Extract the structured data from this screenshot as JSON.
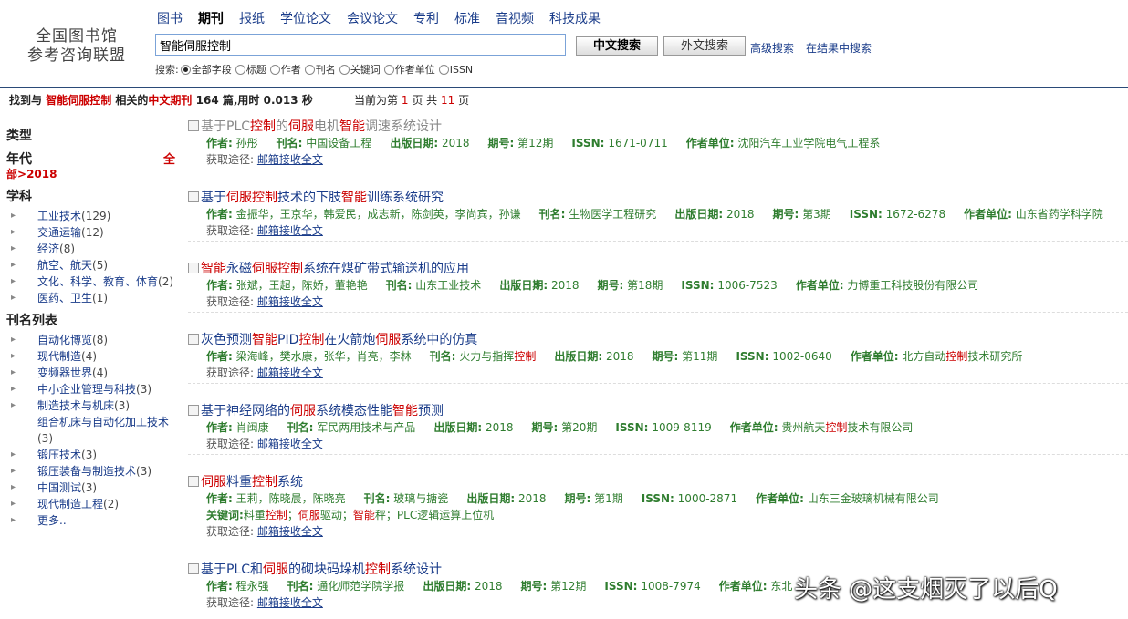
{
  "logo": {
    "line1": "全国图书馆",
    "line2": "参考咨询联盟"
  },
  "topnav": [
    "图书",
    "期刊",
    "报纸",
    "学位论文",
    "会议论文",
    "专利",
    "标准",
    "音视频",
    "科技成果"
  ],
  "search": {
    "value": "智能伺服控制",
    "btn_cn": "中文搜索",
    "btn_foreign": "外文搜索",
    "advanced": "高级搜索",
    "within": "在结果中搜索"
  },
  "searchby": {
    "label": "搜索:",
    "options": [
      "全部字段",
      "标题",
      "作者",
      "刊名",
      "关键词",
      "作者单位",
      "ISSN"
    ]
  },
  "summary": {
    "p1": "找到与",
    "kw": "智能伺服控制",
    "p2": "相关的",
    "type": "中文期刊",
    "count": "164",
    "p3": "篇,用时",
    "time": "0.013",
    "p4": "秒"
  },
  "pager": {
    "p1": "当前为第",
    "cur": "1",
    "p2": "页 共",
    "total": "11",
    "p3": "页"
  },
  "sidebar": {
    "type_heading": "类型",
    "year_heading": "年代",
    "year_all": "全",
    "year_all2": "部",
    "year_sel": ">2018",
    "subject_heading": "学科",
    "subjects": [
      {
        "name": "工业技术",
        "count": "(129)"
      },
      {
        "name": "交通运输",
        "count": "(12)"
      },
      {
        "name": "经济",
        "count": "(8)"
      },
      {
        "name": "航空、航天",
        "count": "(5)"
      },
      {
        "name": "文化、科学、教育、体育",
        "count": "(2)"
      },
      {
        "name": "医药、卫生",
        "count": "(1)"
      }
    ],
    "journal_heading": "刊名列表",
    "journals": [
      {
        "name": "自动化博览",
        "count": "(8)"
      },
      {
        "name": "现代制造",
        "count": "(4)"
      },
      {
        "name": "变频器世界",
        "count": "(4)"
      },
      {
        "name": "中小企业管理与科技",
        "count": "(3)"
      },
      {
        "name": "制造技术与机床",
        "count": "(3)"
      },
      {
        "name": "组合机床与自动化加工技术",
        "count": "(3)"
      },
      {
        "name": "锻压技术",
        "count": "(3)"
      },
      {
        "name": "锻压装备与制造技术",
        "count": "(3)"
      },
      {
        "name": "中国测试",
        "count": "(3)"
      },
      {
        "name": "现代制造工程",
        "count": "(2)"
      },
      {
        "name": "更多..",
        "count": ""
      }
    ]
  },
  "labels": {
    "author": "作者:",
    "journal": "刊名:",
    "date": "出版日期:",
    "issue": "期号:",
    "issn": "ISSN:",
    "unit": "作者单位:",
    "keywords": "关键词:",
    "via": "获取途径:",
    "via_link": "邮箱接收全文"
  },
  "results": [
    {
      "title": [
        [
          "基于PLC",
          0
        ],
        [
          "控制",
          1
        ],
        [
          "的",
          0
        ],
        [
          "伺服",
          1
        ],
        [
          "电机",
          0
        ],
        [
          "智能",
          1
        ],
        [
          "调速系统设计",
          0
        ]
      ],
      "visited": true,
      "author": "孙彤",
      "journal": "中国设备工程",
      "date": "2018",
      "issue": "第12期",
      "issn": "1671-0711",
      "unit": [
        [
          "沈阳汽车工业学院电气工程系",
          0
        ]
      ]
    },
    {
      "title": [
        [
          "基于",
          0
        ],
        [
          "伺服控制",
          1
        ],
        [
          "技术的下肢",
          0
        ],
        [
          "智能",
          1
        ],
        [
          "训练系统研究",
          0
        ]
      ],
      "visited": false,
      "author": "金振华，王京华，韩爱民，成志新，陈剑英，李尚宾，孙谦",
      "journal": "生物医学工程研究",
      "date": "2018",
      "issue": "第3期",
      "issn": "1672-6278",
      "unit": [
        [
          "山东省药学科学院",
          0
        ]
      ]
    },
    {
      "title": [
        [
          "智能",
          1
        ],
        [
          "永磁",
          0
        ],
        [
          "伺服控制",
          1
        ],
        [
          "系统在煤矿带式输送机的应用",
          0
        ]
      ],
      "visited": false,
      "author": "张斌，王超，陈娇，董艳艳",
      "journal": "山东工业技术",
      "date": "2018",
      "issue": "第18期",
      "issn": "1006-7523",
      "unit": [
        [
          "力博重工科技股份有限公司",
          0
        ]
      ]
    },
    {
      "title": [
        [
          "灰色预测",
          0
        ],
        [
          "智能",
          1
        ],
        [
          "PID",
          0
        ],
        [
          "控制",
          1
        ],
        [
          "在火箭炮",
          0
        ],
        [
          "伺服",
          1
        ],
        [
          "系统中的仿真",
          0
        ]
      ],
      "visited": false,
      "author": "梁海峰，樊水康，张华，肖亮，李林",
      "journal": [
        [
          "火力与指挥",
          0
        ],
        [
          "控制",
          1
        ]
      ],
      "date": "2018",
      "issue": "第11期",
      "issn": "1002-0640",
      "unit": [
        [
          "北方自动",
          0
        ],
        [
          "控制",
          1
        ],
        [
          "技术研究所",
          0
        ]
      ]
    },
    {
      "title": [
        [
          "基于神经网络的",
          0
        ],
        [
          "伺服",
          1
        ],
        [
          "系统模态性能",
          0
        ],
        [
          "智能",
          1
        ],
        [
          "预测",
          0
        ]
      ],
      "visited": false,
      "author": "肖闽康",
      "journal": "军民两用技术与产品",
      "date": "2018",
      "issue": "第20期",
      "issn": "1009-8119",
      "unit": [
        [
          "贵州航天",
          0
        ],
        [
          "控制",
          1
        ],
        [
          "技术有限公司",
          0
        ]
      ]
    },
    {
      "title": [
        [
          "伺服",
          1
        ],
        [
          "料重",
          0
        ],
        [
          "控制",
          1
        ],
        [
          "系统",
          0
        ]
      ],
      "visited": false,
      "author": "王莉，陈晓晨，陈晓亮",
      "journal": "玻璃与搪瓷",
      "date": "2018",
      "issue": "第1期",
      "issn": "1000-2871",
      "unit": [
        [
          "山东三金玻璃机械有限公司",
          0
        ]
      ],
      "keywords": [
        [
          "料重",
          0
        ],
        [
          "控制",
          1
        ],
        [
          "；",
          0
        ],
        [
          "伺服",
          1
        ],
        [
          "驱动；",
          0
        ],
        [
          "智能",
          1
        ],
        [
          "秤；PLC逻辑运算上位机",
          0
        ]
      ]
    },
    {
      "title": [
        [
          "基于PLC和",
          0
        ],
        [
          "伺服",
          1
        ],
        [
          "的砌块码垛机",
          0
        ],
        [
          "控制",
          1
        ],
        [
          "系统设计",
          0
        ]
      ],
      "visited": false,
      "author": "程永强",
      "journal": "通化师范学院学报",
      "date": "2018",
      "issue": "第12期",
      "issn": "1008-7974",
      "unit": [
        [
          "东北",
          0
        ]
      ]
    }
  ],
  "watermark": "头条 @这支烟灭了以后Q"
}
